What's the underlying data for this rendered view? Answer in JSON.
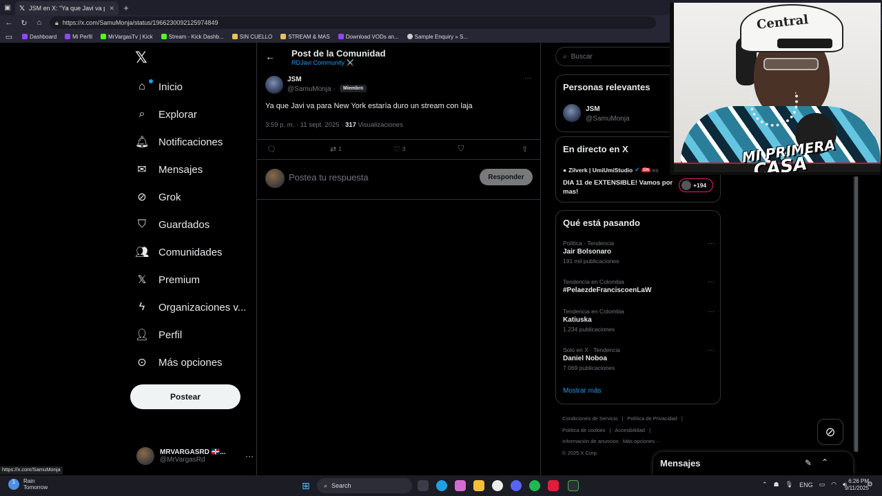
{
  "browser": {
    "tab_title": "JSM en X: \"Ya que Javi va para Ne",
    "url": "https://x.com/SamuMonja/status/1966230092125974849",
    "bookmarks": [
      {
        "label": "Dashboard",
        "color": "#9147ff"
      },
      {
        "label": "Mi Perfil",
        "color": "#9147ff"
      },
      {
        "label": "MrVargasTv | Kick",
        "color": "#53fc18"
      },
      {
        "label": "Stream - Kick Dashb...",
        "color": "#53fc18"
      },
      {
        "label": "SIN CUELLO",
        "color": "#e8c15a"
      },
      {
        "label": "STREAM & MAS",
        "color": "#e8c15a"
      },
      {
        "label": "Download VODs an...",
        "color": "#9147ff"
      },
      {
        "label": "Sample Enquiry » S...",
        "color": "#cccccc"
      }
    ],
    "status_link": "https://x.com/SamuMonja"
  },
  "nav": {
    "items": [
      {
        "label": "Inicio",
        "icon": "home-icon"
      },
      {
        "label": "Explorar",
        "icon": "search-icon"
      },
      {
        "label": "Notificaciones",
        "icon": "bell-icon"
      },
      {
        "label": "Mensajes",
        "icon": "mail-icon"
      },
      {
        "label": "Grok",
        "icon": "grok-icon"
      },
      {
        "label": "Guardados",
        "icon": "bookmark-icon"
      },
      {
        "label": "Comunidades",
        "icon": "people-icon"
      },
      {
        "label": "Premium",
        "icon": "x-logo-icon"
      },
      {
        "label": "Organizaciones v...",
        "icon": "lightning-icon"
      },
      {
        "label": "Perfil",
        "icon": "person-icon"
      },
      {
        "label": "Más opciones",
        "icon": "more-circle-icon"
      }
    ],
    "post_button": "Postear",
    "user": {
      "name": "MRVARGASRD 🇩🇴...",
      "handle": "@MrVargasRd"
    }
  },
  "post": {
    "header_title": "Post de la Comunidad",
    "community": "RDJavi Community ⚔️",
    "author_name": "JSM",
    "author_handle": "@SamuMonja ·",
    "badge": "Miembro",
    "text": "Ya que Javi va para New York estaría duro un stream con laja",
    "time": "3:59 p. m. · 11 sept. 2025 ·",
    "views_count": "317",
    "views_label": "Visualizaciones",
    "retweets": "1",
    "likes": "3",
    "reply_placeholder": "Postea tu respuesta",
    "reply_button": "Responder"
  },
  "right": {
    "search_placeholder": "Buscar",
    "relevant_title": "Personas relevantes",
    "relevant_name": "JSM",
    "relevant_handle": "@SamuMonja",
    "live_title": "En directo en X",
    "live_host": "Zilverk | UmiUmiStudio",
    "live_badge": "EN",
    "live_lang": "es",
    "live_stream_title": "DIA 11 de EXTENSIBLE! Vamos por mas!",
    "live_viewers": "+194",
    "trends_title": "Qué está pasando",
    "trends": [
      {
        "context": "Política · Tendencia",
        "name": "Jair Bolsonaro",
        "count": "191 mil publicaciones"
      },
      {
        "context": "Tendencia en Colombia",
        "name": "#PelaezdeFranciscoenLaW",
        "count": ""
      },
      {
        "context": "Tendencia en Colombia",
        "name": "Katiuska",
        "count": "1.234 publicaciones"
      },
      {
        "context": "Solo en X · Tendencia",
        "name": "Daniel Noboa",
        "count": "7.069 publicaciones"
      }
    ],
    "show_more": "Mostrar más",
    "footer": [
      "Condiciones de Servicio",
      "|",
      "Política de Privacidad",
      "|",
      "Política de cookies",
      "|",
      "Accesibilidad",
      "|",
      "Información de anuncios",
      "Más opciones ···",
      "© 2025 X Corp."
    ]
  },
  "messages_drawer": "Mensajes",
  "overlay": {
    "hat_text": "Central",
    "logo_line1": "MI PRIMERA",
    "logo_line2": "CASA"
  },
  "taskbar": {
    "weather_title": "Rain",
    "weather_sub": "Tomorrow",
    "weather_badge": "1",
    "search_label": "Search",
    "lang": "ENG",
    "time": "6:26 PM",
    "date": "9/11/2025"
  }
}
